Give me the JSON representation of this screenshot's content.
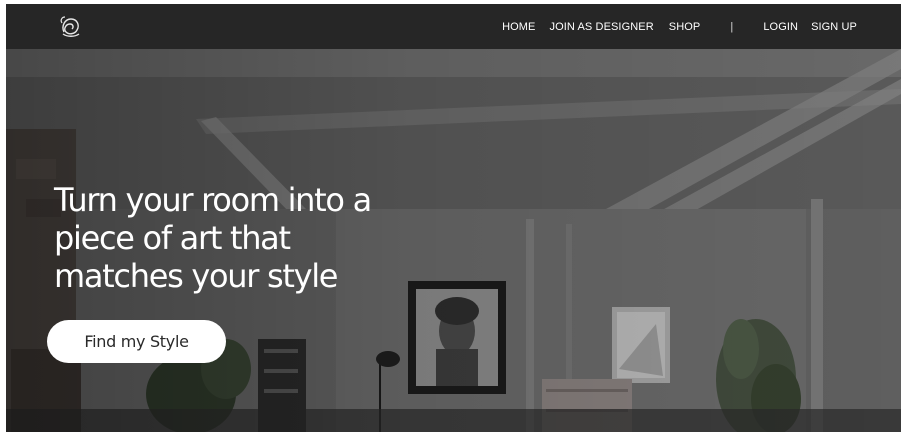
{
  "nav": {
    "logo_icon": "rose-logo-icon",
    "links": {
      "home": "HOME",
      "join_designer": "JOIN AS DESIGNER",
      "shop": "SHOP",
      "separator": "|",
      "login": "LOGIN",
      "signup": "SIGN UP"
    }
  },
  "hero": {
    "title_lines": [
      "Turn your room into a",
      "piece of art that",
      "matches your style"
    ],
    "cta_label": "Find my Style"
  },
  "colors": {
    "navbar_bg": "#262626",
    "text_light": "#ffffff",
    "cta_bg": "#ffffff",
    "cta_text": "#2a2a2a"
  }
}
